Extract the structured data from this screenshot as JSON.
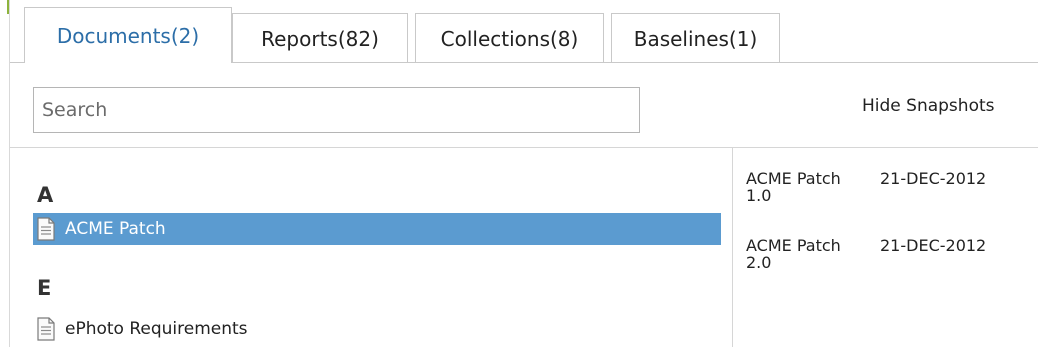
{
  "tabs": [
    {
      "label": "Documents(2)",
      "active": true
    },
    {
      "label": "Reports(82)"
    },
    {
      "label": "Collections(8)"
    },
    {
      "label": "Baselines(1)"
    }
  ],
  "search": {
    "placeholder": "Search",
    "value": ""
  },
  "hide_snapshots_label": "Hide Snapshots",
  "document_groups": [
    {
      "letter": "A",
      "items": [
        {
          "name": "ACME Patch",
          "selected": true,
          "icon": "document-icon"
        }
      ]
    },
    {
      "letter": "E",
      "items": [
        {
          "name": "ePhoto Requirements",
          "selected": false,
          "icon": "document-icon"
        }
      ]
    }
  ],
  "snapshots": [
    {
      "name": "ACME Patch 1.0",
      "date": "21-DEC-2012"
    },
    {
      "name": "ACME Patch 2.0",
      "date": "21-DEC-2012"
    }
  ],
  "colors": {
    "active_tab_text": "#2c6ea8",
    "selection_bg": "#5b9bd0",
    "accent_tick": "#8db33c"
  }
}
